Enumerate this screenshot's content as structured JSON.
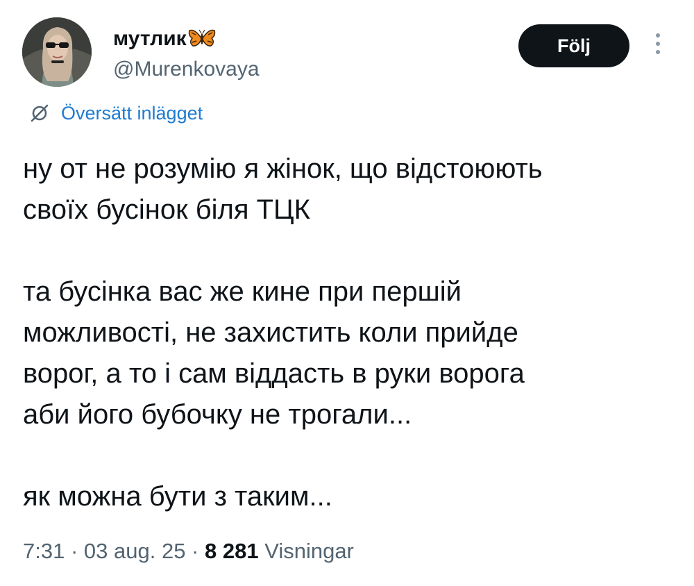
{
  "author": {
    "display_name": "мутлик",
    "handle": "@Murenkovaya"
  },
  "actions": {
    "follow_label": "Följ"
  },
  "translate": {
    "label": "Översätt inlägget"
  },
  "tweet": {
    "lines": [
      "ну от не розумію я жінок, що відстоюють",
      "своїх бусінок біля ТЦК",
      "та бусінка вас же кине при першій",
      "можливості, не захистить коли прийде",
      "ворог, а то і сам віддасть в руки ворога",
      "аби його бубочку не трогали...",
      "як можна бути з таким..."
    ]
  },
  "meta": {
    "time": "7:31",
    "separator": " · ",
    "date": "03 aug. 25",
    "views_count": "8 281",
    "views_label": "Visningar"
  },
  "colors": {
    "text": "#0f1419",
    "secondary": "#536471",
    "link": "#1e7bd1",
    "follow_bg": "#0f1419"
  },
  "icons": {
    "translate": "translate-icon",
    "butterfly": "butterfly-emoji-icon",
    "more": "more-icon"
  }
}
